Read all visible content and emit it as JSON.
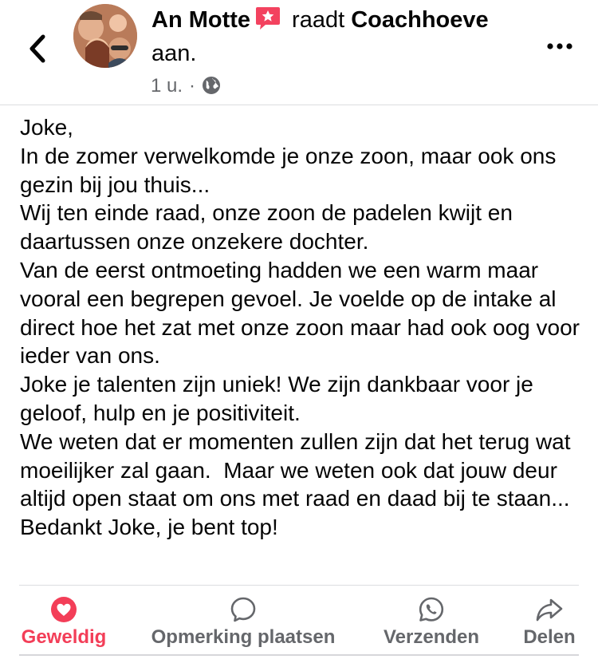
{
  "header": {
    "author": "An Motte",
    "verb": "raadt",
    "target": "Coachhoeve",
    "line2": "aan.",
    "time": "1 u.",
    "separator": "·"
  },
  "post": {
    "text": "Joke,\nIn de zomer verwelkomde je onze zoon, maar ook ons gezin bij jou thuis...\nWij ten einde raad, onze zoon de padelen kwijt en daartussen onze onzekere dochter.\nVan de eerst ontmoeting hadden we een warm maar vooral een begrepen gevoel. Je voelde op de intake al direct hoe het zat met onze zoon maar had ook oog voor ieder van ons.\nJoke je talenten zijn uniek! We zijn dankbaar voor je geloof, hulp en je positiviteit.\nWe weten dat er momenten zullen zijn dat het terug wat moeilijker zal gaan.  Maar we weten ook dat jouw deur altijd open staat om ons met raad en daad bij te staan...\nBedankt Joke, je bent top!"
  },
  "actions": {
    "like": "Geweldig",
    "comment": "Opmerking plaatsen",
    "send": "Verzenden",
    "share": "Delen"
  },
  "colors": {
    "accent_like": "#f33e58",
    "secondary_text": "#65676b",
    "badge": "#f3425f"
  },
  "icons": [
    "back-arrow-icon",
    "recommendation-badge-icon",
    "globe-icon",
    "more-options-icon",
    "heart-icon",
    "comment-bubble-icon",
    "whatsapp-icon",
    "share-arrow-icon"
  ]
}
